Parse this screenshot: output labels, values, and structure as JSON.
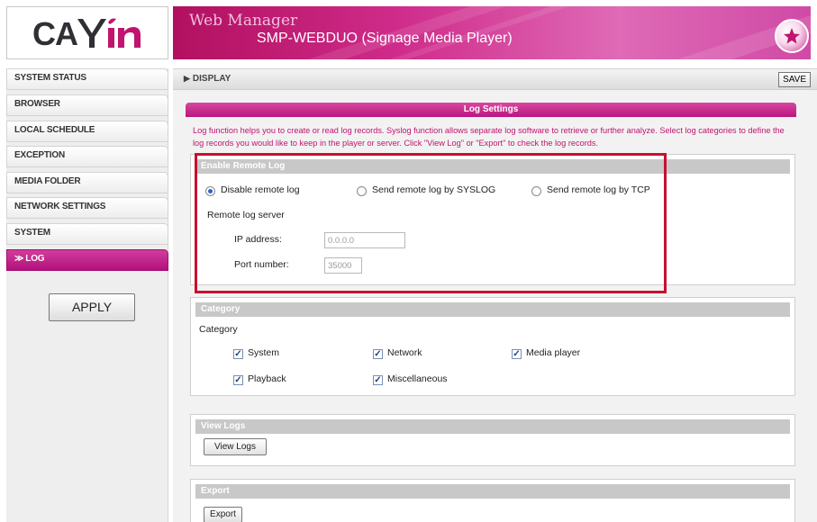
{
  "logo": {
    "text": "CAYIN"
  },
  "header": {
    "app_title": "Web Manager",
    "device_name": "SMP-WEBDUO (Signage Media Player)"
  },
  "sidebar": {
    "items": [
      {
        "label": "SYSTEM STATUS"
      },
      {
        "label": "BROWSER"
      },
      {
        "label": "LOCAL SCHEDULE"
      },
      {
        "label": "EXCEPTION"
      },
      {
        "label": "MEDIA FOLDER"
      },
      {
        "label": "NETWORK SETTINGS"
      },
      {
        "label": "SYSTEM"
      },
      {
        "label": "LOG",
        "active": true
      }
    ],
    "apply_label": "APPLY"
  },
  "topbar": {
    "breadcrumb": "DISPLAY",
    "save_label": "SAVE"
  },
  "log_settings": {
    "title": "Log Settings",
    "description": "Log function helps you to create or read log records. Syslog function allows separate log software to retrieve or further analyze. Select log categories to define the log records you would like to keep in the player or server. Click \"View Log\" or \"Export\" to check the log records."
  },
  "remote_log": {
    "header": "Enable Remote Log",
    "options": [
      {
        "label": "Disable remote log",
        "selected": true
      },
      {
        "label": "Send remote log by SYSLOG",
        "selected": false
      },
      {
        "label": "Send remote log by TCP",
        "selected": false
      }
    ],
    "server_label": "Remote log server",
    "ip_label": "IP address:",
    "ip_value": "0.0.0.0",
    "port_label": "Port number:",
    "port_value": "35000"
  },
  "category": {
    "header": "Category",
    "label": "Category",
    "items": [
      {
        "label": "System",
        "checked": true
      },
      {
        "label": "Network",
        "checked": true
      },
      {
        "label": "Media player",
        "checked": true
      },
      {
        "label": "Playback",
        "checked": true
      },
      {
        "label": "Miscellaneous",
        "checked": true
      }
    ]
  },
  "view_logs": {
    "header": "View Logs",
    "button_label": "View Logs"
  },
  "export": {
    "header": "Export",
    "button_label": "Export"
  },
  "colors": {
    "brand": "#c0146f",
    "highlight_box": "#c8102e"
  }
}
